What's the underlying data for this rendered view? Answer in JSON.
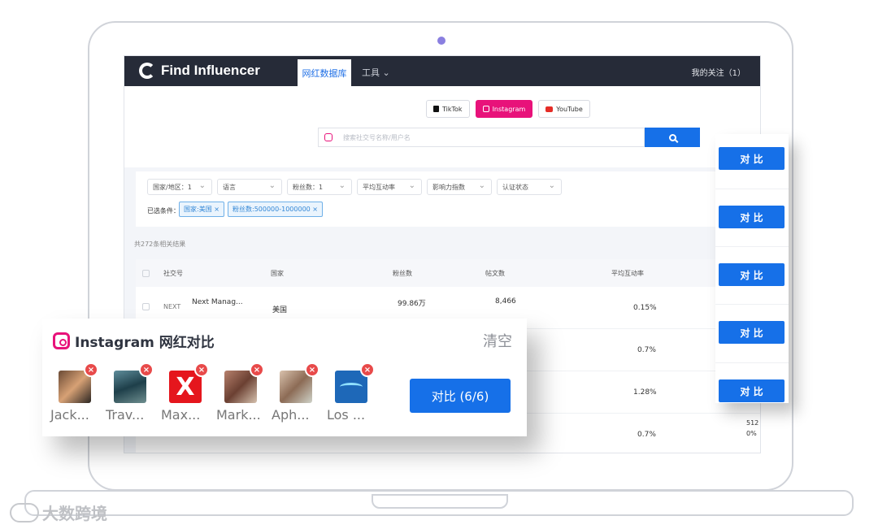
{
  "app": {
    "brand": "Find Influencer",
    "nav": {
      "active_tab": "网红数据库",
      "tools": "工具",
      "follow": "我的关注（1）"
    }
  },
  "platform_tabs": [
    "TikTok",
    "Instagram",
    "YouTube"
  ],
  "search": {
    "placeholder": "搜索社交号名称/用户名"
  },
  "filters": [
    "国家/地区：1",
    "语言",
    "粉丝数：1",
    "平均互动率",
    "影响力指数",
    "认证状态"
  ],
  "selected": {
    "label": "已选条件：",
    "chips": [
      "国家:美国 ×",
      "粉丝数:500000-1000000 ×"
    ]
  },
  "results": {
    "count": "共272条相关结果",
    "headers": {
      "social": "社交号",
      "country": "国家",
      "followers": "粉丝数",
      "posts": "帖文数",
      "engagement": "平均互动率"
    },
    "rows": [
      {
        "name": "Next Manag...",
        "country": "美国",
        "followers": "99.86万",
        "posts": "8,466",
        "engagement": "0.15%"
      },
      {
        "engagement": "0.7%"
      },
      {
        "engagement": "1.28%"
      },
      {
        "engagement": "0.7%"
      }
    ]
  },
  "compare_column": {
    "button_label": "对 比",
    "side_values": [
      "512",
      "0%"
    ]
  },
  "overlay": {
    "title": "Instagram 网红对比",
    "clear": "清空",
    "compare_button": "对比 (6/6)",
    "influencers": [
      {
        "name": "Jack...",
        "avatar": "photo"
      },
      {
        "name": "Trav...",
        "avatar": "photo"
      },
      {
        "name": "Max...",
        "avatar": "red-x-logo"
      },
      {
        "name": "Mark...",
        "avatar": "photo"
      },
      {
        "name": "Aph...",
        "avatar": "photo"
      },
      {
        "name": "Los ...",
        "avatar": "blue-logo"
      }
    ]
  },
  "watermark": "大数跨境"
}
